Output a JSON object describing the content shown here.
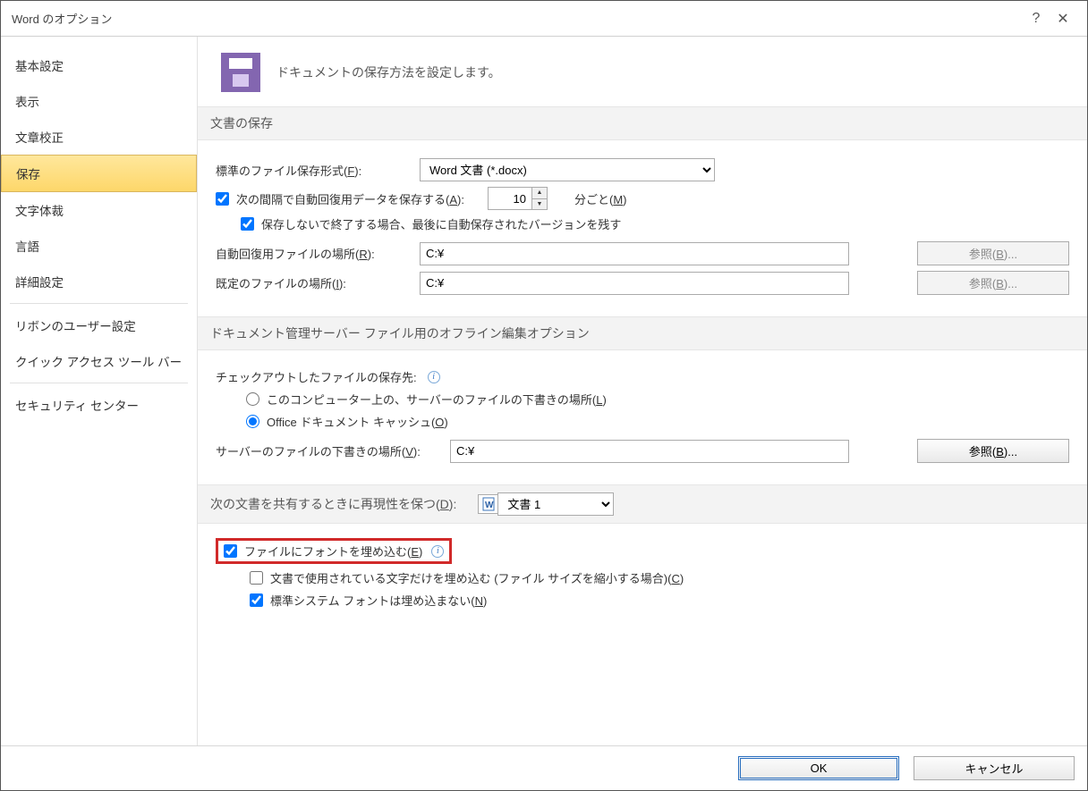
{
  "titlebar": {
    "title": "Word のオプション",
    "help": "?",
    "close": "✕"
  },
  "sidebar": {
    "items": [
      {
        "label": "基本設定"
      },
      {
        "label": "表示"
      },
      {
        "label": "文章校正"
      },
      {
        "label": "保存",
        "selected": true
      },
      {
        "label": "文字体裁"
      },
      {
        "label": "言語"
      },
      {
        "label": "詳細設定"
      },
      {
        "label": "リボンのユーザー設定",
        "sepBefore": true
      },
      {
        "label": "クイック アクセス ツール バー"
      },
      {
        "label": "セキュリティ センター",
        "sepBefore": true
      }
    ]
  },
  "header": {
    "description": "ドキュメントの保存方法を設定します。"
  },
  "section_save": {
    "title": "文書の保存",
    "file_format_label": "標準のファイル保存形式(F):",
    "file_format_value": "Word 文書 (*.docx)",
    "autosave_label": "次の間隔で自動回復用データを保存する(A):",
    "autosave_interval": "10",
    "autosave_unit": "分ごと(M)",
    "keep_last_auto_label": "保存しないで終了する場合、最後に自動保存されたバージョンを残す",
    "autorecover_loc_label": "自動回復用ファイルの場所(R):",
    "autorecover_loc_value": "C:¥",
    "default_loc_label": "既定のファイルの場所(I):",
    "default_loc_value": "C:¥",
    "browse_r": "参照(B)...",
    "browse_i": "参照(B)..."
  },
  "section_offline": {
    "title": "ドキュメント管理サーバー ファイル用のオフライン編集オプション",
    "checkout_label": "チェックアウトしたファイルの保存先:",
    "radio_local": "このコンピューター上の、サーバーのファイルの下書きの場所(L)",
    "radio_cache": "Office ドキュメント キャッシュ(O)",
    "drafts_loc_label": "サーバーのファイルの下書きの場所(V):",
    "drafts_loc_value": "C:¥",
    "browse_v": "参照(B)..."
  },
  "section_share": {
    "title_prefix": "次の文書を共有するときに再現性を保つ(D):",
    "doc_combo_value": "文書 1",
    "embed_fonts": "ファイルにフォントを埋め込む(E)",
    "embed_subset": "文書で使用されている文字だけを埋め込む (ファイル サイズを縮小する場合)(C)",
    "no_system_fonts": "標準システム フォントは埋め込まない(N)"
  },
  "footer": {
    "ok": "OK",
    "cancel": "キャンセル"
  }
}
